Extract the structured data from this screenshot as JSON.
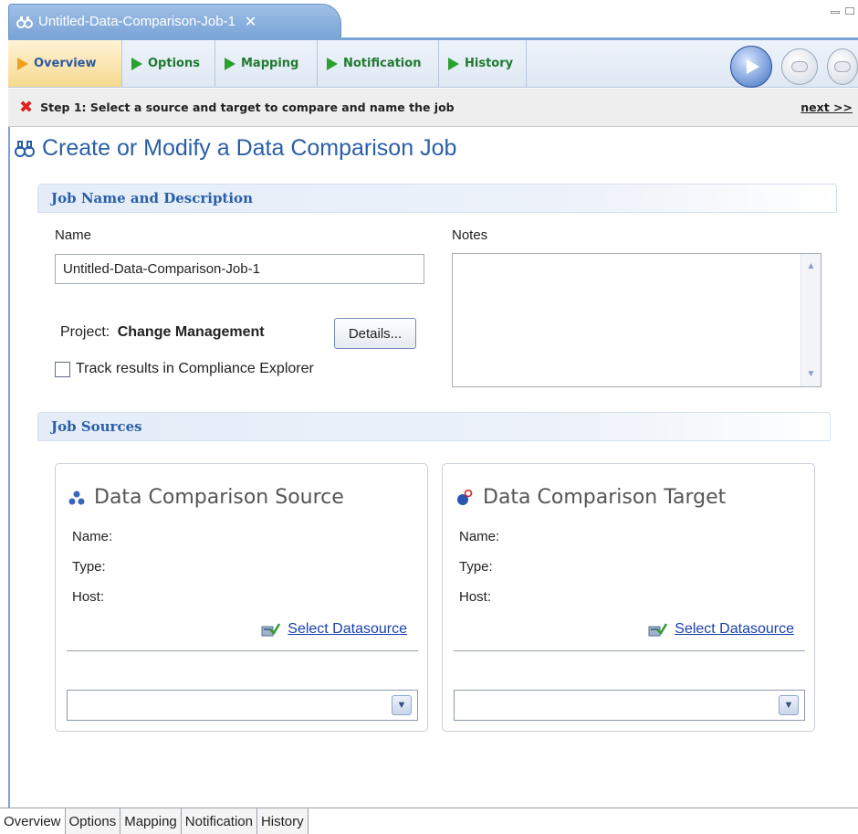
{
  "editor": {
    "tab_title": "Untitled-Data-Comparison-Job-1",
    "close_symbol": "✕"
  },
  "page_tabs": [
    {
      "label": "Overview",
      "active": true
    },
    {
      "label": "Options",
      "active": false
    },
    {
      "label": "Mapping",
      "active": false
    },
    {
      "label": "Notification",
      "active": false
    },
    {
      "label": "History",
      "active": false
    }
  ],
  "step": {
    "text": "Step 1: Select a source and target to compare and name the job",
    "next_label": "next >>"
  },
  "page_title": "Create or Modify a Data Comparison Job",
  "job_name_section": {
    "header": "Job Name and Description",
    "name_label": "Name",
    "name_value": "Untitled-Data-Comparison-Job-1",
    "notes_label": "Notes",
    "notes_value": "",
    "project_prefix": "Project:",
    "project_name": "Change Management",
    "details_button": "Details...",
    "track_label": "Track results in Compliance Explorer",
    "track_checked": false
  },
  "job_sources_section": {
    "header": "Job Sources",
    "source": {
      "title": "Data Comparison Source",
      "name_label": "Name:",
      "type_label": "Type:",
      "host_label": "Host:",
      "select_label": "Select Datasource",
      "combo_value": ""
    },
    "target": {
      "title": "Data Comparison Target",
      "name_label": "Name:",
      "type_label": "Type:",
      "host_label": "Host:",
      "select_label": "Select Datasource",
      "combo_value": ""
    }
  },
  "bottom_tabs": [
    {
      "label": "Overview",
      "active": true
    },
    {
      "label": "Options",
      "active": false
    },
    {
      "label": "Mapping",
      "active": false
    },
    {
      "label": "Notification",
      "active": false
    },
    {
      "label": "History",
      "active": false
    }
  ],
  "colors": {
    "accent_blue": "#2a5fa8",
    "tab_green": "#1f7a2f",
    "link_blue": "#1a3fb0",
    "error_red": "#d22222"
  }
}
